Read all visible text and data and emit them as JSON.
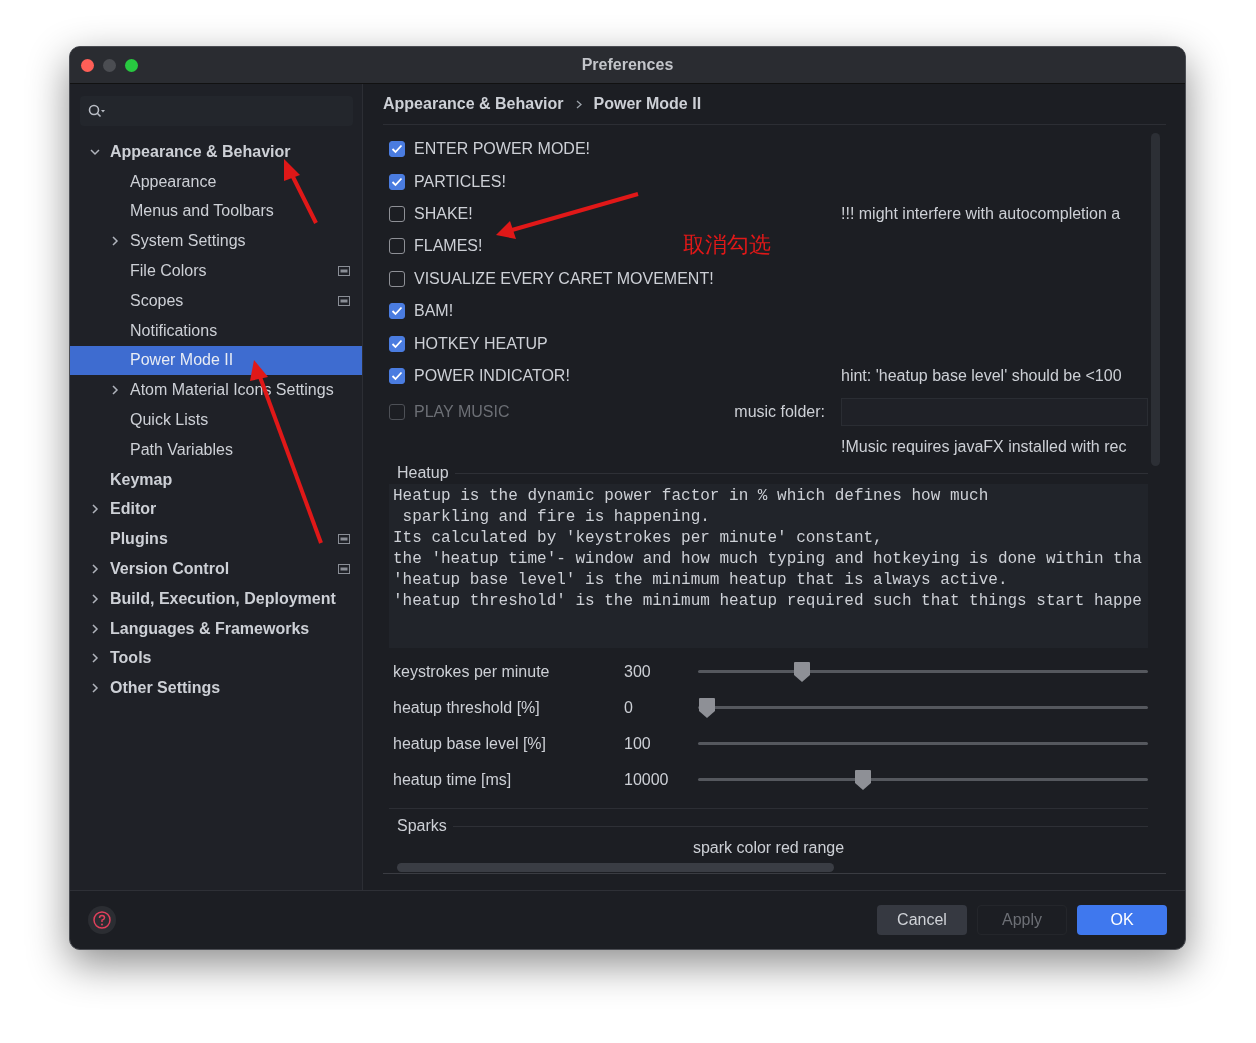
{
  "window": {
    "title": "Preferences"
  },
  "sidebar": {
    "items": [
      {
        "label": "Appearance & Behavior",
        "expanded": true,
        "selected": false,
        "project_icon": false,
        "children": [
          {
            "label": "Appearance",
            "selected": false,
            "project_icon": false
          },
          {
            "label": "Menus and Toolbars",
            "selected": false,
            "project_icon": false
          },
          {
            "label": "System Settings",
            "expanded": false,
            "selected": false,
            "project_icon": false
          },
          {
            "label": "File Colors",
            "selected": false,
            "project_icon": true
          },
          {
            "label": "Scopes",
            "selected": false,
            "project_icon": true
          },
          {
            "label": "Notifications",
            "selected": false,
            "project_icon": false
          },
          {
            "label": "Power Mode II",
            "selected": true,
            "project_icon": false
          },
          {
            "label": "Atom Material Icons Settings",
            "expanded": false,
            "selected": false,
            "project_icon": false
          },
          {
            "label": "Quick Lists",
            "selected": false,
            "project_icon": false
          },
          {
            "label": "Path Variables",
            "selected": false,
            "project_icon": false
          }
        ]
      },
      {
        "label": "Keymap",
        "selected": false,
        "project_icon": false
      },
      {
        "label": "Editor",
        "expanded": false,
        "selected": false,
        "project_icon": false
      },
      {
        "label": "Plugins",
        "selected": false,
        "project_icon": true
      },
      {
        "label": "Version Control",
        "expanded": false,
        "selected": false,
        "project_icon": true
      },
      {
        "label": "Build, Execution, Deployment",
        "expanded": false,
        "selected": false,
        "project_icon": false
      },
      {
        "label": "Languages & Frameworks",
        "expanded": false,
        "selected": false,
        "project_icon": false
      },
      {
        "label": "Tools",
        "expanded": false,
        "selected": false,
        "project_icon": false
      },
      {
        "label": "Other Settings",
        "expanded": false,
        "selected": false,
        "project_icon": false
      }
    ]
  },
  "breadcrumb": [
    "Appearance & Behavior",
    "Power Mode II"
  ],
  "options": [
    {
      "label": "ENTER POWER MODE!",
      "checked": true,
      "disabled": false
    },
    {
      "label": "PARTICLES!",
      "checked": true,
      "disabled": false
    },
    {
      "label": "SHAKE!",
      "checked": false,
      "disabled": false,
      "note": "!!! might interfere with autocompletion a"
    },
    {
      "label": "FLAMES!",
      "checked": false,
      "disabled": false
    },
    {
      "label": "VISUALIZE EVERY CARET MOVEMENT!",
      "checked": false,
      "disabled": false
    },
    {
      "label": "BAM!",
      "checked": true,
      "disabled": false
    },
    {
      "label": "HOTKEY HEATUP",
      "checked": true,
      "disabled": false
    },
    {
      "label": "POWER INDICATOR!",
      "checked": true,
      "disabled": false,
      "note": "hint: 'heatup base level' should be <100"
    },
    {
      "label": "PLAY MUSIC",
      "checked": false,
      "disabled": true
    }
  ],
  "music_folder": {
    "label": "music folder:",
    "note": "!Music requires javaFX installed with rec"
  },
  "heatup": {
    "title": "Heatup",
    "description": [
      "Heatup is the dynamic power factor in % which defines how much",
      " sparkling and fire is happening.",
      "Its calculated by 'keystrokes per minute' constant,",
      "the 'heatup time'- window and how much typing and hotkeying is done within tha",
      "'heatup base level' is the minimum heatup that is always active.",
      "'heatup threshold' is the minimum heatup required such that things start happe"
    ],
    "sliders": [
      {
        "label": "keystrokes per minute",
        "reading": "300",
        "level": 0.22
      },
      {
        "label": "heatup threshold [%]",
        "reading": "0",
        "level": 0
      },
      {
        "label": "heatup base level [%]",
        "reading": "100"
      },
      {
        "label": "heatup time [ms]",
        "reading": "10000",
        "level": 0.36
      }
    ]
  },
  "sparks": {
    "title": "Sparks",
    "label": "spark color red range"
  },
  "annotation": {
    "text": "取消勾选"
  },
  "buttons": [
    {
      "label": "Cancel",
      "kind": "secondary"
    },
    {
      "label": "Apply",
      "kind": "disabled"
    },
    {
      "label": "OK",
      "kind": "primary"
    }
  ]
}
